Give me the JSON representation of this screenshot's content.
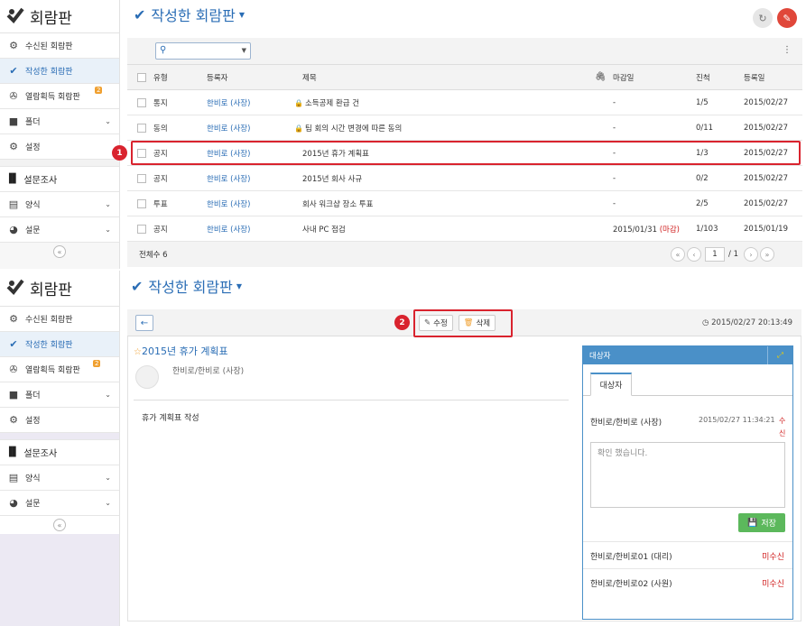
{
  "sidebar": {
    "app_title": "회람판",
    "items": [
      {
        "label": "수신된 회람판"
      },
      {
        "label": "작성한 회람판"
      },
      {
        "label": "열람획득 회람판",
        "badge": "2"
      },
      {
        "label": "폴더"
      },
      {
        "label": "설정"
      }
    ],
    "survey_title": "설문조사",
    "survey_items": [
      {
        "label": "양식"
      },
      {
        "label": "설문"
      }
    ],
    "collapse": "«"
  },
  "page_title": "작성한 회람판",
  "list": {
    "headers": {
      "type": "유형",
      "author": "등록자",
      "title": "제목",
      "deadline": "마감일",
      "progress": "진척",
      "date": "등록일"
    },
    "rows": [
      {
        "type": "통지",
        "author": "한비로 (사장)",
        "title": "소득공제 환급 건",
        "locked": true,
        "deadline": "-",
        "deadline_note": "",
        "progress": "1/5",
        "date": "2015/02/27"
      },
      {
        "type": "동의",
        "author": "한비로 (사장)",
        "title": "팀 회의 시간 변경에 따른 동의",
        "locked": true,
        "deadline": "-",
        "deadline_note": "",
        "progress": "0/11",
        "date": "2015/02/27"
      },
      {
        "type": "공지",
        "author": "한비로 (사장)",
        "title": "2015년 휴가 계획표",
        "locked": false,
        "deadline": "-",
        "deadline_note": "",
        "progress": "1/3",
        "date": "2015/02/27"
      },
      {
        "type": "공지",
        "author": "한비로 (사장)",
        "title": "2015년 회사 사규",
        "locked": false,
        "deadline": "-",
        "deadline_note": "",
        "progress": "0/2",
        "date": "2015/02/27"
      },
      {
        "type": "투표",
        "author": "한비로 (사장)",
        "title": "회사 워크샵 장소 투표",
        "locked": false,
        "deadline": "-",
        "deadline_note": "",
        "progress": "2/5",
        "date": "2015/02/27"
      },
      {
        "type": "공지",
        "author": "한비로 (사장)",
        "title": "사내 PC 점검",
        "locked": false,
        "deadline": "2015/01/31",
        "deadline_note": "(마감)",
        "progress": "1/103",
        "date": "2015/01/19"
      }
    ],
    "total": "전체수 6",
    "page_current": "1",
    "page_total": "/ 1"
  },
  "markers": {
    "one": "1",
    "two": "2"
  },
  "detail": {
    "edit_label": "수정",
    "delete_label": "삭제",
    "timestamp": "2015/02/27 20:13:49",
    "doc_title": "2015년 휴가 계획표",
    "doc_author": "한비로/한비로 (사장)",
    "body": "휴가 계획표 작성"
  },
  "panel": {
    "header": "대상자",
    "tab": "대상자",
    "reply_author": "한비로/한비로 (사장)",
    "reply_time": "2015/02/27 11:34:21",
    "reply_status_1": "수",
    "reply_status_2": "신",
    "reply_text": "확인 했습니다.",
    "save_label": "저장",
    "recipients": [
      {
        "name": "한비로/한비로01 (대리)",
        "status": "미수신"
      },
      {
        "name": "한비로/한비로02 (사원)",
        "status": "미수신"
      }
    ]
  },
  "colors": {
    "accent": "#2a6db5",
    "highlight": "#d9232e",
    "badge": "#f0a030",
    "save": "#5cb85c",
    "panel": "#4a90c8"
  }
}
